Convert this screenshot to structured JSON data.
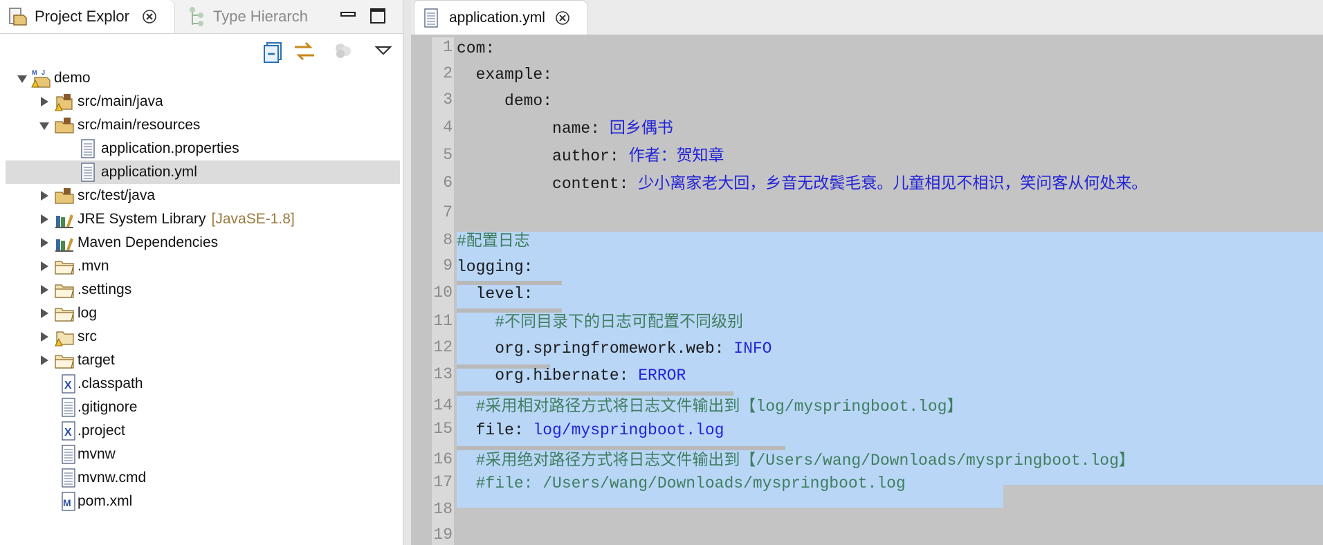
{
  "left_pane": {
    "tabs": [
      {
        "label": "Project Explor",
        "active": true
      },
      {
        "label": "Type Hierarch",
        "active": false
      }
    ],
    "tree": [
      {
        "label": "demo",
        "expanded": true,
        "icon": "maven-project-icon"
      },
      {
        "label": "src/main/java",
        "expanded": false,
        "icon": "source-folder-warning-icon"
      },
      {
        "label": "src/main/resources",
        "expanded": true,
        "icon": "source-folder-icon"
      },
      {
        "label": "application.properties",
        "icon": "text-file-icon"
      },
      {
        "label": "application.yml",
        "icon": "text-file-icon",
        "selected": true
      },
      {
        "label": "src/test/java",
        "expanded": false,
        "icon": "source-folder-icon"
      },
      {
        "label": "JRE System Library",
        "decoration": "[JavaSE-1.8]",
        "expanded": false,
        "icon": "library-icon"
      },
      {
        "label": "Maven Dependencies",
        "expanded": false,
        "icon": "library-icon"
      },
      {
        "label": ".mvn",
        "expanded": false,
        "icon": "folder-icon"
      },
      {
        "label": ".settings",
        "expanded": false,
        "icon": "folder-icon"
      },
      {
        "label": "log",
        "expanded": false,
        "icon": "folder-icon"
      },
      {
        "label": "src",
        "expanded": false,
        "icon": "folder-warning-icon"
      },
      {
        "label": "target",
        "expanded": false,
        "icon": "folder-icon"
      },
      {
        "label": ".classpath",
        "icon": "xml-file-icon"
      },
      {
        "label": ".gitignore",
        "icon": "text-file-icon"
      },
      {
        "label": ".project",
        "icon": "xml-file-icon"
      },
      {
        "label": "mvnw",
        "icon": "text-file-icon"
      },
      {
        "label": "mvnw.cmd",
        "icon": "text-file-icon"
      },
      {
        "label": "pom.xml",
        "icon": "maven-pom-icon"
      }
    ]
  },
  "editor": {
    "tab_label": "application.yml",
    "lines": [
      {
        "n": "1",
        "key": "com:",
        "value": ""
      },
      {
        "n": "2",
        "key": "  example:",
        "value": ""
      },
      {
        "n": "3",
        "key": "     demo:",
        "value": ""
      },
      {
        "n": "4",
        "key": "          name: ",
        "value": "回乡偶书"
      },
      {
        "n": "5",
        "key": "          author: ",
        "value": "作者：贺知章"
      },
      {
        "n": "6",
        "key": "          content: ",
        "value": "少小离家老大回，乡音无改鬓毛衰。儿童相见不相识，笑问客从何处来。"
      },
      {
        "n": "7",
        "key": "",
        "value": ""
      },
      {
        "n": "8",
        "comment": "#配置日志"
      },
      {
        "n": "9",
        "key": "logging:",
        "value": ""
      },
      {
        "n": "10",
        "key": "  level:",
        "value": ""
      },
      {
        "n": "11",
        "comment": "    #不同目录下的日志可配置不同级别"
      },
      {
        "n": "12",
        "key": "    org.springfromework.web: ",
        "value": "INFO"
      },
      {
        "n": "13",
        "key": "    org.hibernate: ",
        "value": "ERROR"
      },
      {
        "n": "14",
        "comment": "  #采用相对路径方式将日志文件输出到【log/myspringboot.log】"
      },
      {
        "n": "15",
        "key": "  file: ",
        "value": "log/myspringboot.log"
      },
      {
        "n": "16",
        "comment": "  #采用绝对路径方式将日志文件输出到【/Users/wang/Downloads/myspringboot.log】"
      },
      {
        "n": "17",
        "comment": "  #file: /Users/wang/Downloads/myspringboot.log"
      },
      {
        "n": "18",
        "key": "",
        "value": ""
      },
      {
        "n": "19",
        "key": "",
        "value": ""
      }
    ]
  },
  "colors": {
    "selection": "#b9d6f7",
    "value_text": "#2323d8",
    "comment_text": "#3f7f5f",
    "editor_bg": "#c4c4c4"
  }
}
